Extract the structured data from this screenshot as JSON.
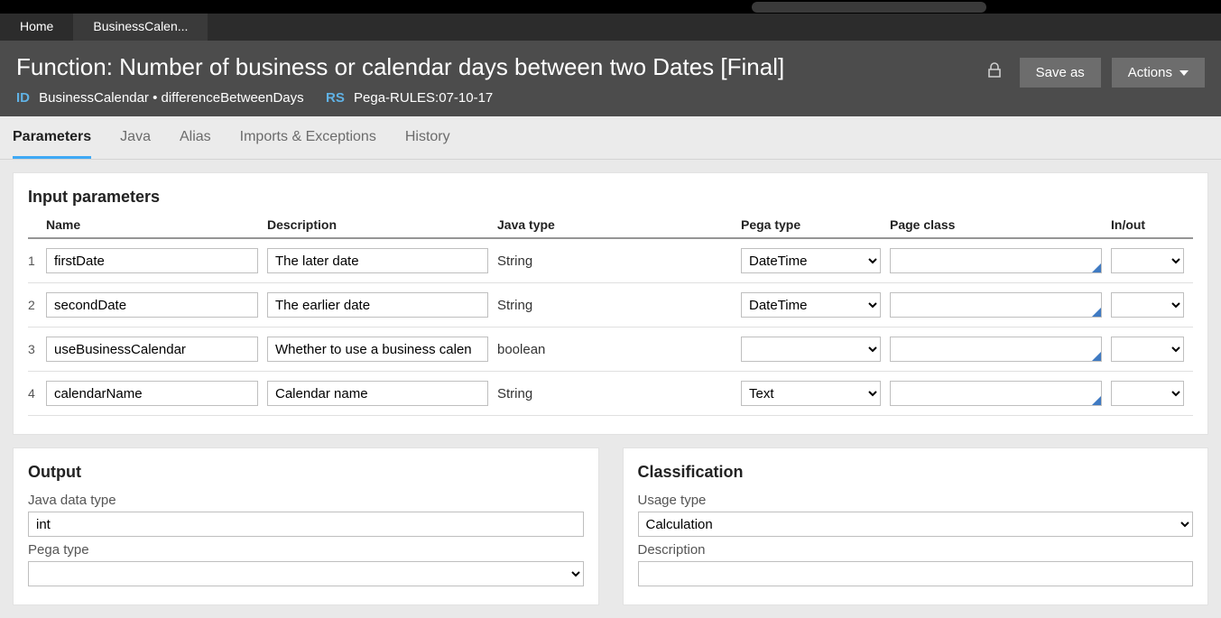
{
  "topTabs": {
    "home": "Home",
    "current": "BusinessCalen..."
  },
  "header": {
    "title": "Function: Number of business or calendar days between two Dates [Final]",
    "idLabel": "ID",
    "idValue": "BusinessCalendar • differenceBetweenDays",
    "rsLabel": "RS",
    "rsValue": "Pega-RULES:07-10-17",
    "saveAs": "Save as",
    "actions": "Actions"
  },
  "ruleTabs": {
    "parameters": "Parameters",
    "java": "Java",
    "alias": "Alias",
    "imports": "Imports & Exceptions",
    "history": "History"
  },
  "inputParams": {
    "heading": "Input parameters",
    "cols": {
      "name": "Name",
      "desc": "Description",
      "jt": "Java type",
      "pt": "Pega type",
      "pc": "Page class",
      "io": "In/out"
    },
    "rows": [
      {
        "idx": "1",
        "name": "firstDate",
        "desc": "The later date",
        "jt": "String",
        "pt": "DateTime",
        "pc": "",
        "io": ""
      },
      {
        "idx": "2",
        "name": "secondDate",
        "desc": "The earlier date",
        "jt": "String",
        "pt": "DateTime",
        "pc": "",
        "io": ""
      },
      {
        "idx": "3",
        "name": "useBusinessCalendar",
        "desc": "Whether to use a business calen",
        "jt": "boolean",
        "pt": "",
        "pc": "",
        "io": ""
      },
      {
        "idx": "4",
        "name": "calendarName",
        "desc": "Calendar name",
        "jt": "String",
        "pt": "Text",
        "pc": "",
        "io": ""
      }
    ]
  },
  "output": {
    "heading": "Output",
    "javaTypeLabel": "Java data type",
    "javaTypeValue": "int",
    "pegaTypeLabel": "Pega type",
    "pegaTypeValue": ""
  },
  "classification": {
    "heading": "Classification",
    "usageLabel": "Usage type",
    "usageValue": "Calculation",
    "descLabel": "Description",
    "descValue": ""
  }
}
